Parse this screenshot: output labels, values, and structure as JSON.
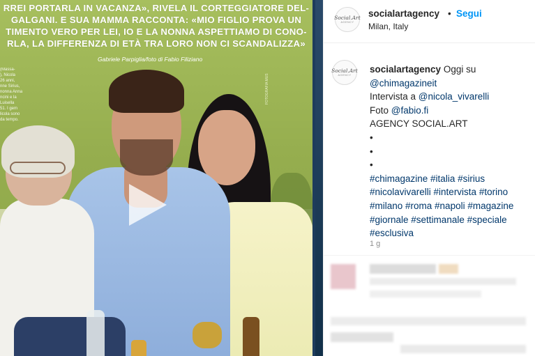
{
  "media": {
    "headline_lines": [
      "RREI PORTARLA IN VACANZA», RIVELA IL CORTEGGIATORE DEL-",
      "GALGANI. E SUA MAMMA RACCONTA: «MIO FIGLIO PROVA UN",
      "TIMENTO VERO PER LEI, IO E LA NONNA ASPETTIAMO DI CONO-",
      "RLA, LA DIFFERENZA DI ETÀ TRA LORO NON CI SCANDALIZZA»"
    ],
    "credit": "Gabriele Parpiglia/foto di Fabio Filiziano",
    "caption_lines": [
      "(Massa-",
      "), Nicola",
      "26 anni,",
      "nne Sirius,",
      "nonna Anna",
      "ncini e la",
      "Luisella",
      "51. I gem",
      "licola sono",
      "da tempo."
    ],
    "side_credit": "FOTOGRAFIA MUS",
    "play_icon": "play-icon"
  },
  "header": {
    "avatar_text": "Social.Art",
    "avatar_sub": "AGENCY",
    "username": "socialartagency",
    "dot": "•",
    "follow_label": "Segui",
    "location": "Milan, Italy"
  },
  "caption": {
    "username": "socialartagency",
    "intro": "Oggi su",
    "mention_magazine": "@chimagazineit",
    "interview_prefix": "Intervista a",
    "mention_interview": "@nicola_vivarelli",
    "photo_prefix": "Foto",
    "mention_photo": "@fabio.fi",
    "agency": "AGENCY SOCIAL.ART",
    "bullet": "•",
    "hashtag_lines": [
      "#chimagazine #italia #sirius",
      "#nicolavivarelli #intervista #torino",
      "#milano #roma #napoli #magazine",
      "#giornale #settimanale #speciale",
      "#esclusiva"
    ],
    "timestamp": "1 g"
  },
  "colors": {
    "link": "#00376b",
    "follow": "#0095f6",
    "muted": "#8e8e8e",
    "text": "#262626"
  }
}
